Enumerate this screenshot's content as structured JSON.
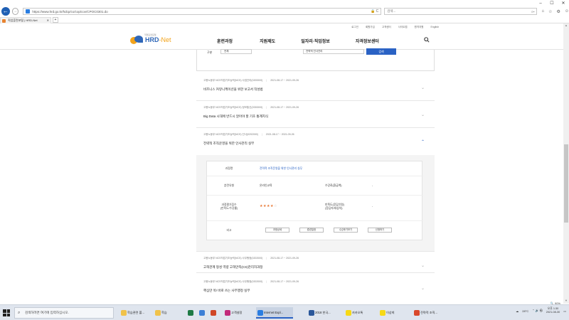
{
  "browser": {
    "url": "https://www.hrd.go.kr/hdcp/co/cop/cov/CPOC0301.do",
    "search_placeholder": "검색...",
    "tab_title": "직업훈련포털 | HRD-Net"
  },
  "site": {
    "logo_main": "HRD",
    "logo_sub": "-Net",
    "logo_tagline": "직업훈련포털",
    "util_links": [
      "로그인",
      "회원가입",
      "고객센터",
      "사이트맵",
      "원격지원",
      "English"
    ],
    "gnb": [
      "훈련과정",
      "지원제도",
      "일자리·직업정보",
      "자격정보센터"
    ]
  },
  "search": {
    "label": "구분",
    "select_value": "전체",
    "input_value": "전략적 인사관리",
    "button": "검색"
  },
  "courses": [
    {
      "meta": "고용노동부 NCS직업기초능력(NCS) 사업관리(0200000)",
      "period": "2021-08-17 ~ 2021-09-26",
      "name": "비즈니스 커뮤니케이션을 위한 보고서 작성법"
    },
    {
      "meta": "고용노동부 NCS직업기초능력(NCS) 정보통신(2000000)",
      "period": "2021-08-17 ~ 2021-09-26",
      "name": "Big Data 시대에 반드시 알아야 할 기초 통계지식"
    },
    {
      "meta": "고용노동부 NCS직업기초능력(NCS) 인사(0202000)",
      "period": "2021-08-17 ~ 2021-09-26",
      "name": "전략적 조직운영을 위한 인사관리 실무"
    },
    {
      "meta": "고용노동부 NCS직업기초능력(NCS) 사무행정(0202000)",
      "period": "2021-08-17 ~ 2021-09-26",
      "name": "고객관계 형성 역량 고객만족(CS)관리자과정"
    },
    {
      "meta": "고용노동부 NCS직업기초능력(NCS) 사무행정(0202000)",
      "period": "2021-08-17 ~ 2021-09-26",
      "name": "핵심만 쏙! 바로 쓰는 사무행정 실무"
    }
  ],
  "detail": {
    "course_label": "과정명",
    "course_value": "전략적 조직운영을 위한 인사관리 실무",
    "type_label": "훈련유형",
    "type_value": "온라인교육",
    "fee_label": "수강료(환급액)",
    "fee_value": "-",
    "rating_label": "과정평가점수\n(만족도/수강률)",
    "stars_filled": "★★★★",
    "stars_empty": "☆",
    "rate_label": "만족도(응답인원)\n(응답자/대상자)",
    "rate_value": "-",
    "etc_label": "비고",
    "buttons": [
      "과정상세",
      "훈련일정",
      "수강후기보기",
      "신청하기"
    ]
  },
  "status": {
    "zoom": "90%"
  },
  "taskbar": {
    "search_text": "검색하려면 여기에 입력하십시오.",
    "apps": [
      "학습관련 폴...",
      "학습",
      "고객설정",
      "Internet Expl...",
      "2018 한국...",
      "카카오톡",
      "이상희",
      "전략적 조직..."
    ],
    "weather": "28°C",
    "time": "오후 1:30",
    "date": "2021-08-30"
  },
  "colors": {
    "accent": "#2a62c4",
    "logo_blue": "#2f67b8",
    "logo_orange": "#f2a31b",
    "star": "#e8752f"
  }
}
